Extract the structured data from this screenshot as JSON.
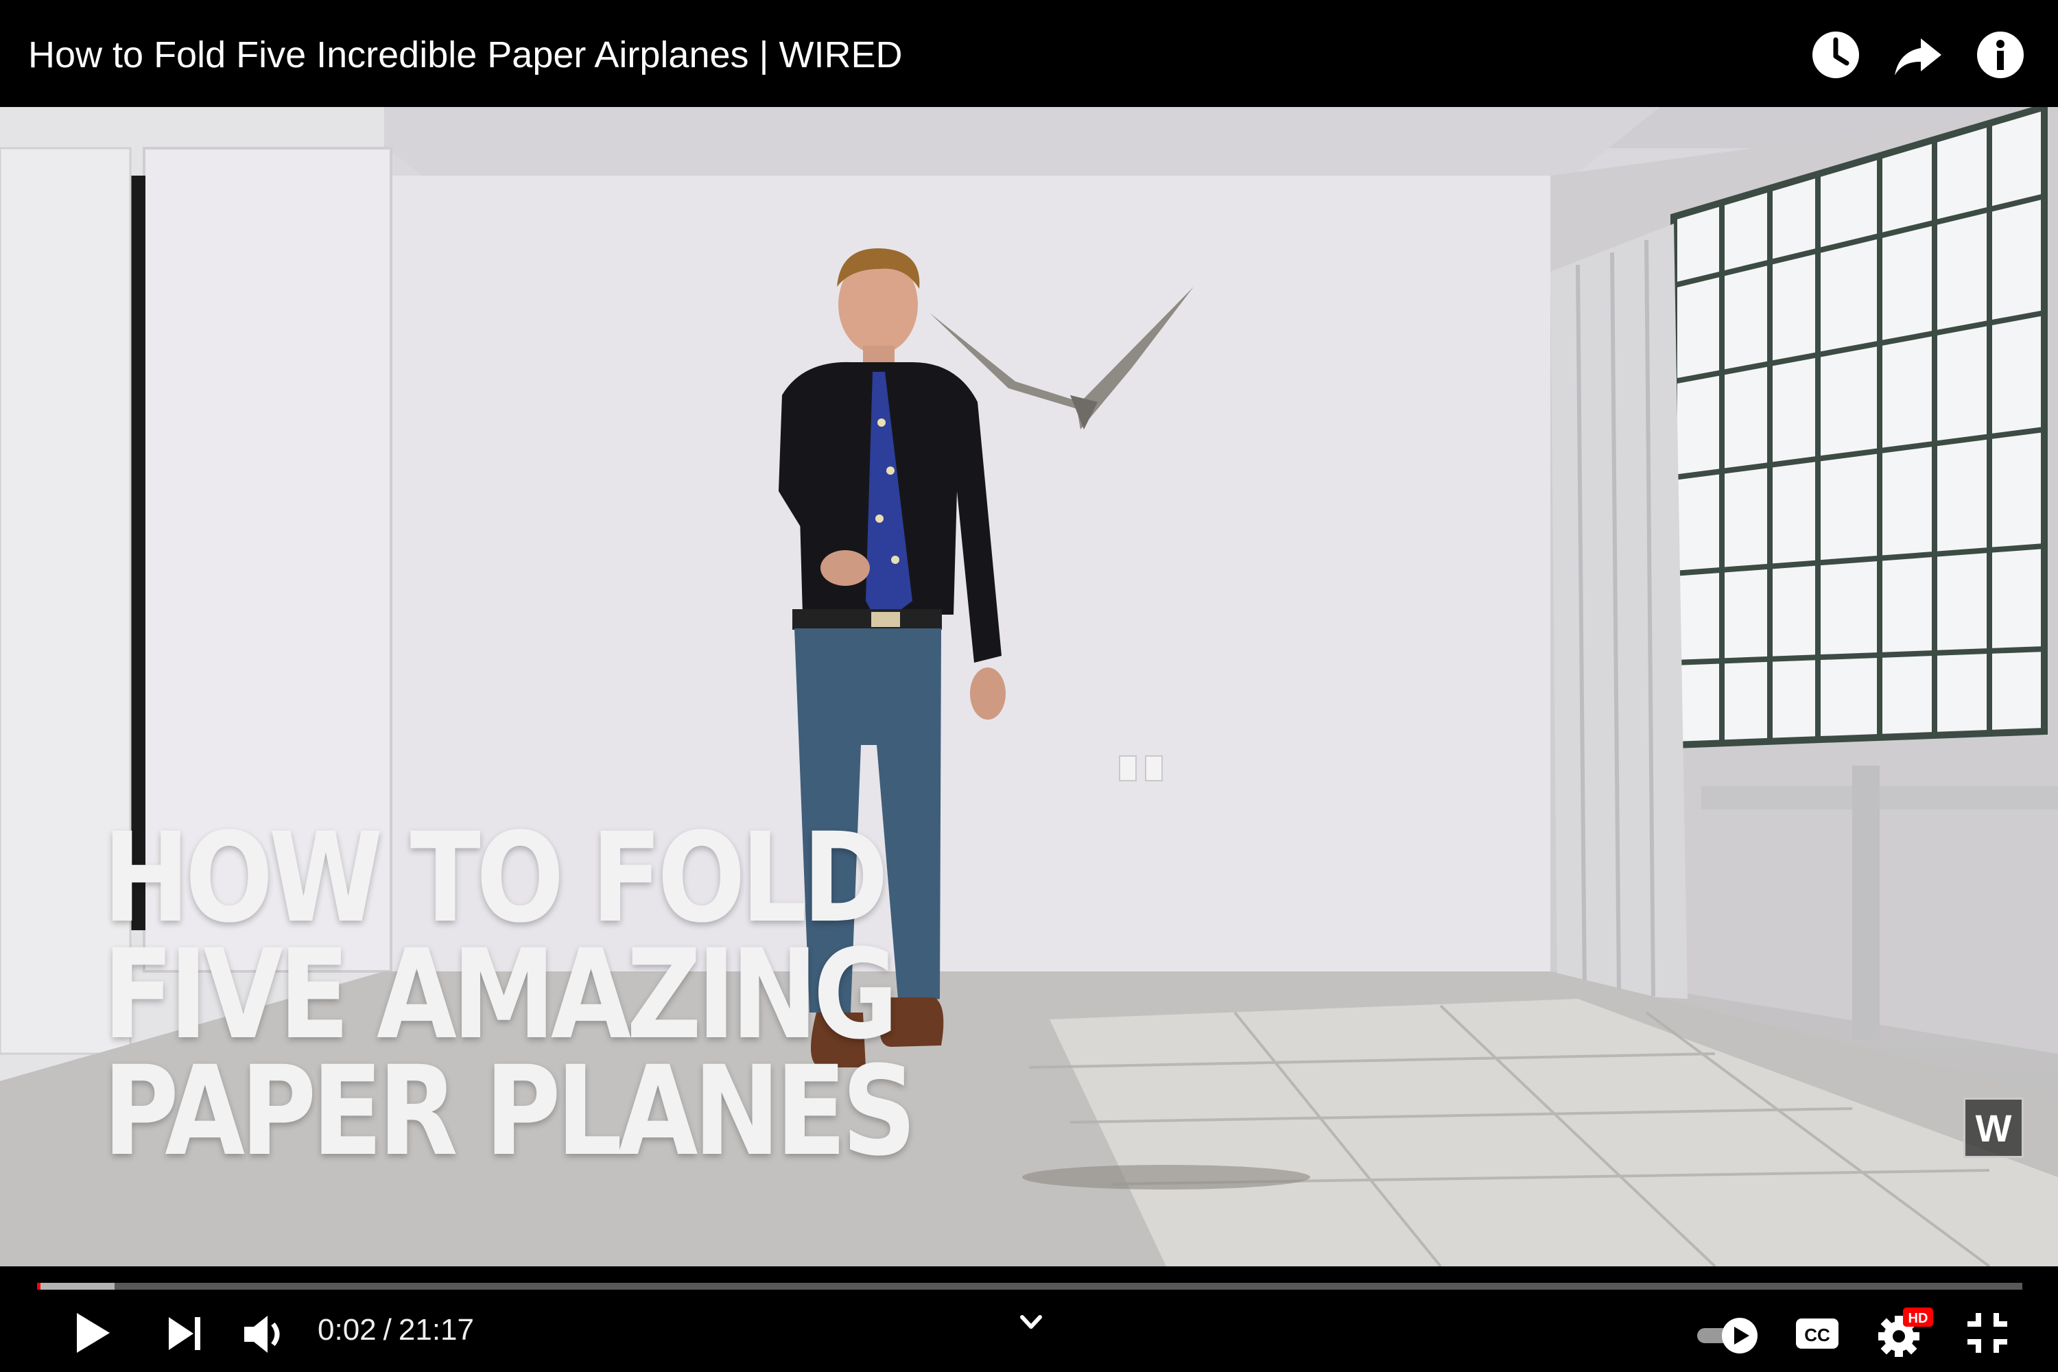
{
  "video": {
    "title": "How to Fold Five Incredible Paper Airplanes | WIRED",
    "overlay_lines": [
      "HOW TO FOLD",
      "FIVE AMAZING",
      "PAPER PLANES"
    ],
    "channel_watermark": "W"
  },
  "top_actions": {
    "icons": [
      "watch-later-icon",
      "share-icon",
      "info-icon"
    ]
  },
  "player": {
    "current_time": "0:02",
    "separator": "/",
    "duration": "21:17",
    "progress_fraction": 0.0016,
    "buffered_fraction": 0.039,
    "autoplay": true,
    "captions_label": "CC",
    "quality_badge": "HD",
    "accent_color": "#ff0000",
    "icons": [
      "play-icon",
      "next-icon",
      "volume-icon",
      "chevron-down-icon",
      "autoplay-toggle-icon",
      "captions-icon",
      "settings-icon",
      "exit-fullscreen-icon"
    ]
  }
}
